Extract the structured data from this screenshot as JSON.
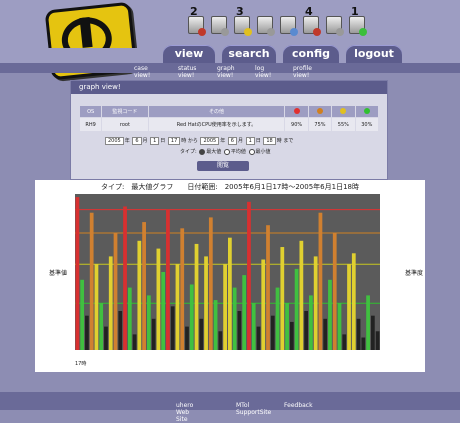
{
  "header": {
    "icons": [
      {
        "name": "red-alert-icon",
        "num": "2",
        "color": "#c0392b"
      },
      {
        "name": "gray-status-icon",
        "num": "",
        "color": "#999999"
      },
      {
        "name": "yellow-alert-icon",
        "num": "3",
        "color": "#e0c020"
      },
      {
        "name": "gray-status-icon-2",
        "num": "",
        "color": "#999999"
      },
      {
        "name": "monitor-icon",
        "num": "",
        "color": "#5a8ad0"
      },
      {
        "name": "red-alert-icon-2",
        "num": "4",
        "color": "#c0392b"
      },
      {
        "name": "gray-status-icon-3",
        "num": "",
        "color": "#999999"
      },
      {
        "name": "green-alert-icon",
        "num": "1",
        "color": "#3bbf3b"
      }
    ]
  },
  "nav": {
    "tabs": [
      "view",
      "search",
      "config",
      "logout"
    ],
    "subitems": [
      "case view!",
      "status view!",
      "graph view!",
      "log view!",
      "profile view!"
    ]
  },
  "panel": {
    "title": "graph view!",
    "table": {
      "headers": [
        "OS",
        "監視コード",
        "その他",
        "",
        "",
        "",
        ""
      ],
      "row": [
        "RH9",
        "root",
        "Red HatのCPU使用率を示します。",
        "",
        "90%",
        "75%",
        "55%",
        "30%"
      ]
    },
    "range": {
      "y1": "2005",
      "m1": "6",
      "d1": "1",
      "h1": "17",
      "to_label": "から",
      "y2": "2005",
      "m2": "6",
      "d2": "1",
      "h2": "18",
      "end_label": "まで"
    },
    "type_label": "タイプ:",
    "radios": [
      "最大値",
      "平均値",
      "最小値"
    ],
    "show_button": "閲覧"
  },
  "chart_data": {
    "type": "bar",
    "title": "タイプ:　最大値グラフ　　日付範囲:　2005年6月1日17時～2005年6月1日18時",
    "ylabel_left": "基準値",
    "ylabel_right": "基準度",
    "ylim": [
      0,
      100
    ],
    "values": [
      98,
      45,
      22,
      88,
      55,
      30,
      15,
      60,
      75,
      25,
      92,
      40,
      10,
      70,
      82,
      35,
      20,
      65,
      50,
      90,
      28,
      55,
      78,
      15,
      42,
      68,
      20,
      60,
      85,
      32,
      12,
      55,
      72,
      40,
      25,
      48,
      95,
      30,
      15,
      58,
      80,
      22,
      40,
      66,
      30,
      18,
      52,
      70,
      25,
      35,
      60,
      88,
      20,
      45,
      75,
      30,
      10,
      55,
      62,
      20,
      8,
      35,
      22,
      12
    ],
    "thresholds": [
      {
        "value": 90,
        "color": "#e03030"
      },
      {
        "value": 75,
        "color": "#d08020"
      },
      {
        "value": 55,
        "color": "#c8c820"
      },
      {
        "value": 30,
        "color": "#30c030"
      }
    ],
    "xlabel": "17時"
  },
  "footer": {
    "links": [
      "uhero Web Site",
      "MTol SupportSite",
      "Feedback"
    ]
  }
}
